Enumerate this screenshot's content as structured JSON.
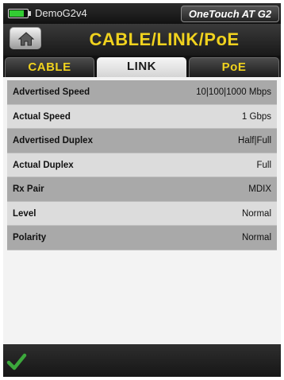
{
  "status_bar": {
    "device_name": "DemoG2v4",
    "model": "OneTouch AT G2",
    "battery_level": 0.8
  },
  "header": {
    "title": "CABLE/LINK/PoE",
    "home_icon": "home-icon"
  },
  "tabs": [
    {
      "label": "CABLE",
      "active": false
    },
    {
      "label": "LINK",
      "active": true
    },
    {
      "label": "PoE",
      "active": false
    }
  ],
  "link_table": [
    {
      "label": "Advertised Speed",
      "value": "10|100|1000 Mbps"
    },
    {
      "label": "Actual Speed",
      "value": "1 Gbps"
    },
    {
      "label": "Advertised Duplex",
      "value": "Half|Full"
    },
    {
      "label": "Actual Duplex",
      "value": "Full"
    },
    {
      "label": "Rx Pair",
      "value": "MDIX"
    },
    {
      "label": "Level",
      "value": "Normal"
    },
    {
      "label": "Polarity",
      "value": "Normal"
    }
  ],
  "footer": {
    "confirm_icon": "checkmark-icon"
  },
  "colors": {
    "accent_yellow": "#f0d21e",
    "battery_green": "#33cc33",
    "check_green": "#3ca83c"
  }
}
